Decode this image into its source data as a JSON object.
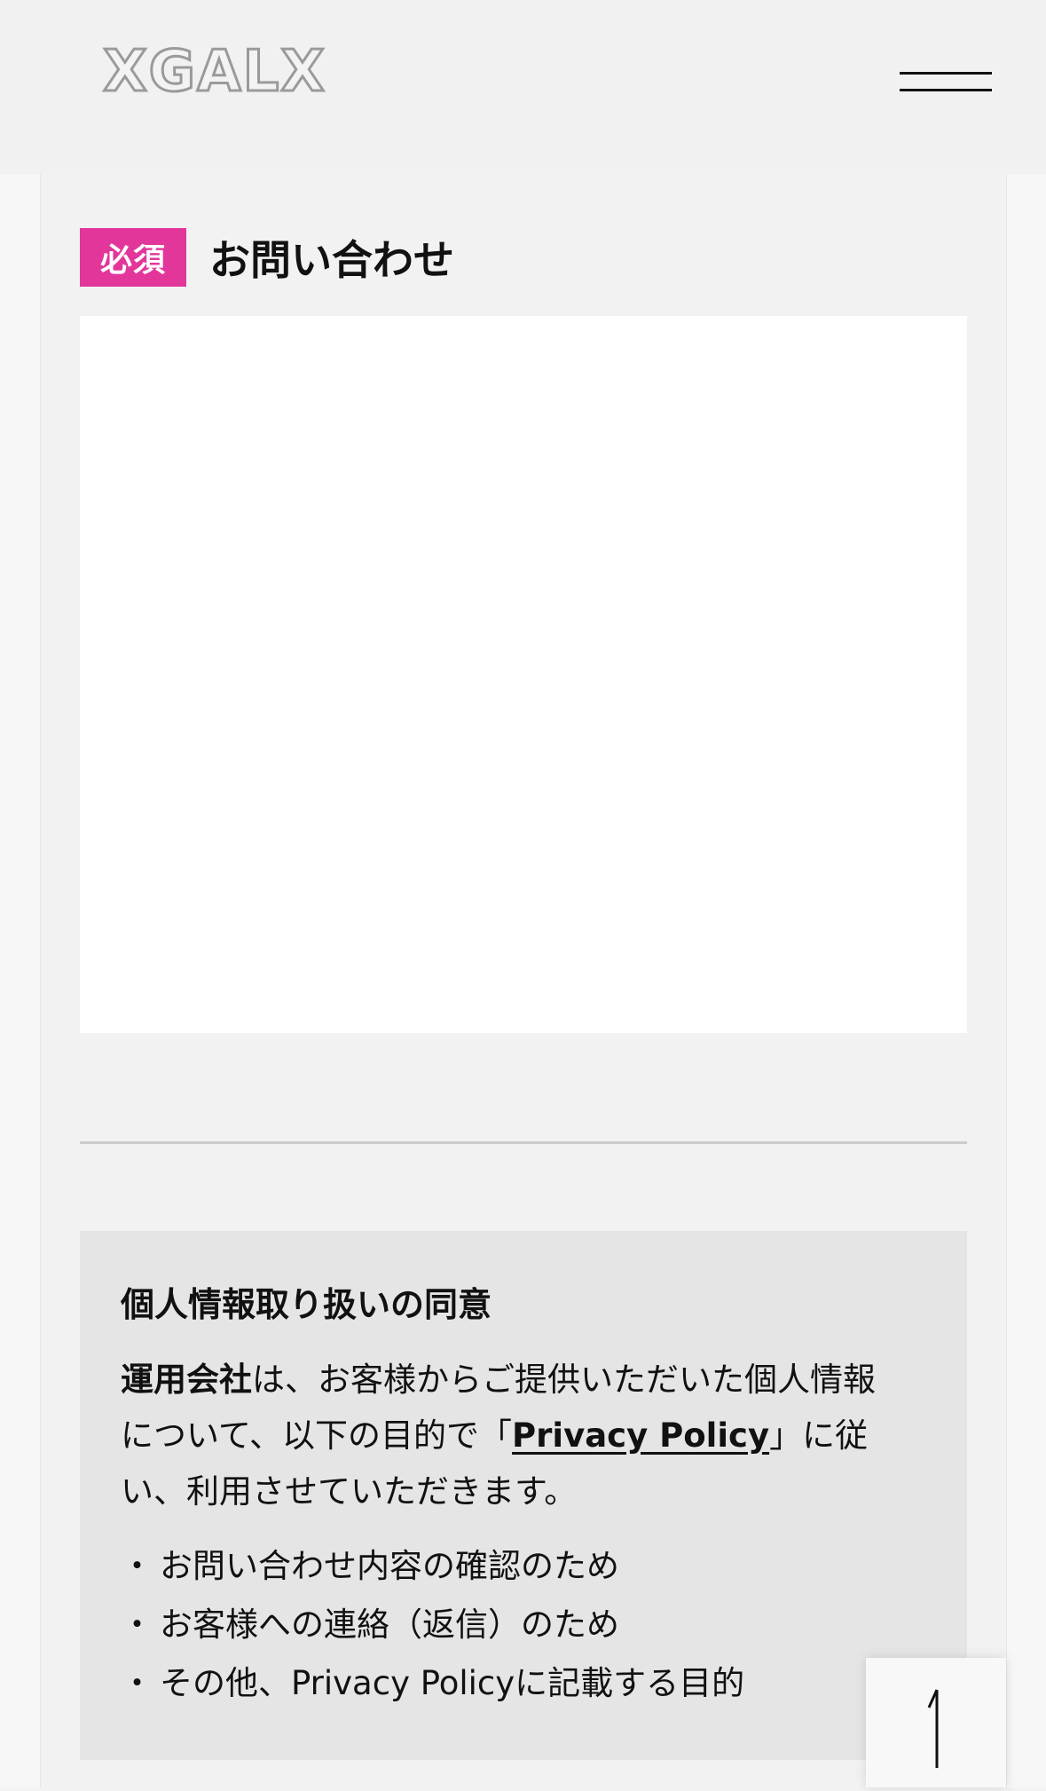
{
  "header": {
    "logo_text": "XGALX",
    "menu_icon": "hamburger-menu-icon"
  },
  "form": {
    "required_label": "必須",
    "field_label": "お問い合わせ",
    "textarea_value": "",
    "textarea_placeholder": ""
  },
  "consent": {
    "title": "個人情報取り扱いの同意",
    "company": "運用会社",
    "body_before_link": "は、お客様からご提供いただいた個人情報について、以下の目的で「",
    "link_text": "Privacy Policy",
    "body_after_link": "」に従い、利用させていただきます。",
    "purposes": [
      "お問い合わせ内容の確認のため",
      "お客様への連絡（返信）のため",
      "その他、Privacy Policyに記載する目的"
    ],
    "bullet": "・"
  },
  "back_to_top": {
    "icon": "up-arrow-icon"
  },
  "colors": {
    "required_badge": "#e2369a",
    "page_background": "#f2f2f2",
    "consent_background": "#e5e5e5"
  }
}
